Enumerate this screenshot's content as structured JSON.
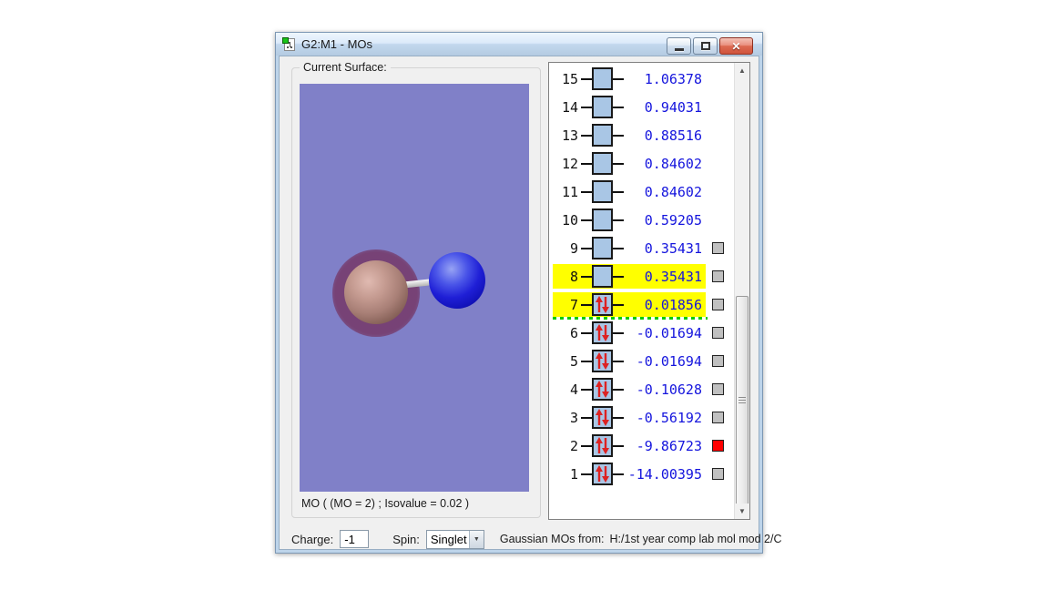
{
  "window": {
    "title": "G2:M1 - MOs",
    "icons": {
      "window_icon": "molecule-document",
      "minimize": "–",
      "maximize": "▢",
      "close": "✕",
      "combo_arrow": "▼",
      "scroll_up": "▲",
      "scroll_down": "▼"
    }
  },
  "colors": {
    "viewport_bg": "#8080c8",
    "highlight": "#ffff00",
    "energy_text": "#1515dd",
    "orbital_box": "#a9c6e5",
    "arrow_red": "#dd2222",
    "homo_lumo_line": "#00cc00",
    "checkbox_gray": "#c0c0c0",
    "checkbox_red": "#ff0000",
    "atom_brown": "#a87f76",
    "atom_blue": "#1a1acc",
    "surface_maroon": "#6e1f3c"
  },
  "surface_panel": {
    "group_label": "Current Surface:",
    "caption": "MO ( (MO = 2) ; Isovalue = 0.02 )"
  },
  "mo_list": {
    "rows": [
      {
        "n": "15",
        "energy": "1.06378",
        "occupied": false,
        "highlighted": false,
        "checkbox": false
      },
      {
        "n": "14",
        "energy": "0.94031",
        "occupied": false,
        "highlighted": false,
        "checkbox": false
      },
      {
        "n": "13",
        "energy": "0.88516",
        "occupied": false,
        "highlighted": false,
        "checkbox": false
      },
      {
        "n": "12",
        "energy": "0.84602",
        "occupied": false,
        "highlighted": false,
        "checkbox": false
      },
      {
        "n": "11",
        "energy": "0.84602",
        "occupied": false,
        "highlighted": false,
        "checkbox": false
      },
      {
        "n": "10",
        "energy": "0.59205",
        "occupied": false,
        "highlighted": false,
        "checkbox": false
      },
      {
        "n": "9",
        "energy": "0.35431",
        "occupied": false,
        "highlighted": false,
        "checkbox": true
      },
      {
        "n": "8",
        "energy": "0.35431",
        "occupied": false,
        "highlighted": true,
        "checkbox": true
      },
      {
        "n": "7",
        "energy": "0.01856",
        "occupied": true,
        "highlighted": true,
        "checkbox": true,
        "separator_below": true
      },
      {
        "n": "6",
        "energy": "-0.01694",
        "occupied": true,
        "highlighted": false,
        "checkbox": true
      },
      {
        "n": "5",
        "energy": "-0.01694",
        "occupied": true,
        "highlighted": false,
        "checkbox": true
      },
      {
        "n": "4",
        "energy": "-0.10628",
        "occupied": true,
        "highlighted": false,
        "checkbox": true
      },
      {
        "n": "3",
        "energy": "-0.56192",
        "occupied": true,
        "highlighted": false,
        "checkbox": true
      },
      {
        "n": "2",
        "energy": "-9.86723",
        "occupied": true,
        "highlighted": false,
        "checkbox": true,
        "checkbox_color": "#ff0000"
      },
      {
        "n": "1",
        "energy": "-14.00395",
        "occupied": true,
        "highlighted": false,
        "checkbox": true
      }
    ]
  },
  "footer": {
    "charge_label": "Charge:",
    "charge_value": "-1",
    "spin_label": "Spin:",
    "spin_value": "Singlet",
    "source_label": "Gaussian MOs from:",
    "source_value": "H:/1st year comp lab mol mod 2/C"
  }
}
